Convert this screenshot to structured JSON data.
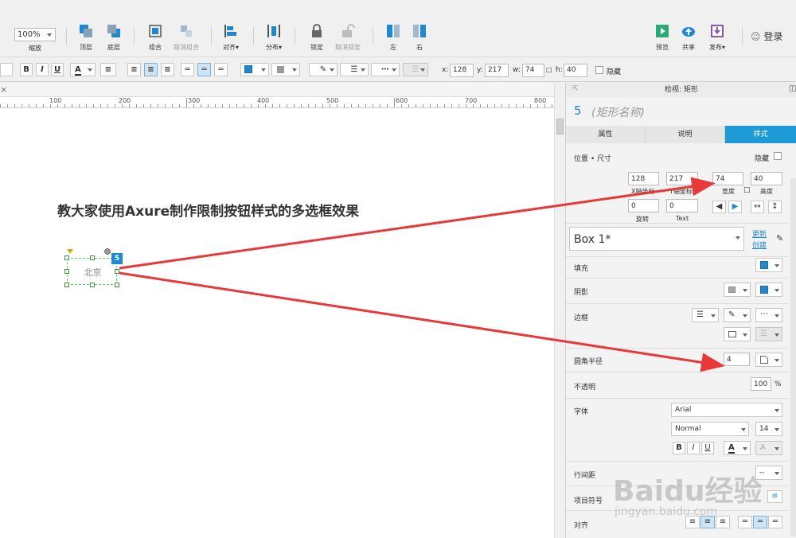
{
  "toolbar": {
    "zoom_value": "100%",
    "zoom_label": "缩放",
    "top_layer": "顶层",
    "bottom_layer": "底层",
    "group": "组合",
    "ungroup": "取消组合",
    "align": "对齐▾",
    "distribute": "分布▾",
    "lock": "锁定",
    "unlock": "取消锁定",
    "left": "左",
    "right": "右",
    "preview": "预览",
    "share": "共享",
    "publish": "发布▾",
    "login": "登录"
  },
  "format_bar": {
    "bold": "B",
    "italic": "I",
    "underline": "U",
    "font_color": "A",
    "x_label": "x:",
    "x_value": "128",
    "y_label": "y:",
    "y_value": "217",
    "w_label": "w:",
    "w_value": "74",
    "h_label": "h:",
    "h_value": "40",
    "hidden_label": "隐藏"
  },
  "ruler": {
    "ticks": [
      "100",
      "200",
      "300",
      "400",
      "500",
      "600",
      "700",
      "800"
    ]
  },
  "canvas": {
    "heading": "教大家使用Axure制作限制按钮样式的多选框效果",
    "widget_text": "北京",
    "widget_badge": "5"
  },
  "inspector": {
    "header": "检视: 矩形",
    "widget_number": "5",
    "widget_name": "(矩形名称)",
    "tabs": [
      "属性",
      "说明",
      "样式"
    ],
    "active_tab": "样式",
    "pos_size_label": "位置 • 尺寸",
    "hidden_label": "隐藏",
    "x": "128",
    "y": "217",
    "w": "74",
    "h": "40",
    "x_label": "X轴坐标",
    "y_label": "Y轴坐标",
    "w_label": "宽度",
    "h_label": "高度",
    "rotation": "0",
    "text_rotation": "0",
    "rotation_label": "旋转",
    "text_label": "Text",
    "style_name": "Box 1*",
    "update_link": "更新",
    "create_link": "创建",
    "fill_label": "填充",
    "shadow_label": "阴影",
    "border_label": "边框",
    "radius_label": "圆角半径",
    "radius_value": "4",
    "opacity_label": "不透明",
    "opacity_value": "100",
    "opacity_unit": "%",
    "font_label": "字体",
    "font_family": "Arial",
    "font_style": "Normal",
    "font_size": "14",
    "line_spacing_label": "行间距",
    "line_spacing_value": "--",
    "bullet_label": "项目符号",
    "align_label": "对齐"
  },
  "colors": {
    "accent": "#1e9ad6",
    "arrow": "#e8393a",
    "fill": "#1e88d0"
  },
  "watermark": {
    "brand": "Baidu经验",
    "url": "jingyan.baidu.com"
  }
}
